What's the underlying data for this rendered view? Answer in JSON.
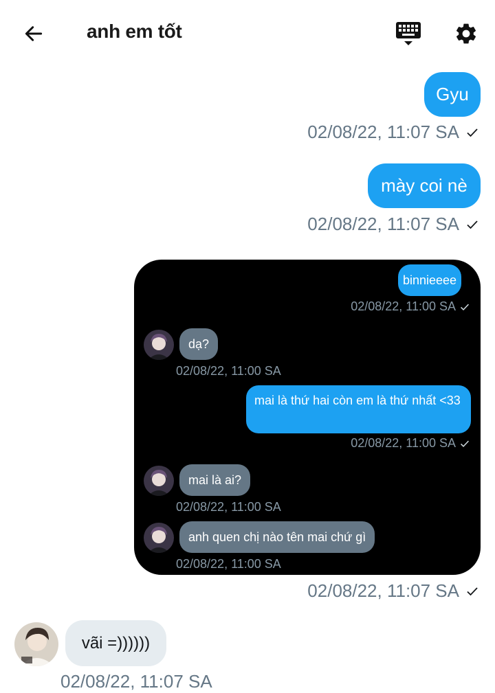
{
  "header": {
    "title": "anh em tốt",
    "back_icon": "arrow-left-icon",
    "keyboard_icon": "keyboard-icon",
    "settings_icon": "gear-icon"
  },
  "colors": {
    "outgoing": "#1da1f2",
    "incoming": "#e6ecf0",
    "timestamp": "#657786"
  },
  "messages": [
    {
      "text": "Gyu",
      "time": "02/08/22, 11:07 SA",
      "direction": "outgoing"
    },
    {
      "text": "mày coi nè",
      "time": "02/08/22, 11:07 SA",
      "direction": "outgoing"
    },
    {
      "type": "image",
      "time": "02/08/22, 11:07 SA",
      "direction": "outgoing"
    },
    {
      "text": "vãi =))))))",
      "time": "02/08/22, 11:07 SA",
      "direction": "incoming"
    }
  ],
  "screenshot": {
    "messages": [
      {
        "text": "binnieeee",
        "time": "02/08/22, 11:00 SA",
        "direction": "outgoing"
      },
      {
        "text": "dạ?",
        "time": "02/08/22, 11:00 SA",
        "direction": "incoming"
      },
      {
        "text": "mai là thứ hai còn em là thứ nhất <33",
        "time": "02/08/22, 11:00 SA",
        "direction": "outgoing"
      },
      {
        "text": "mai là ai?",
        "time": "02/08/22, 11:00 SA",
        "direction": "incoming"
      },
      {
        "text": "anh quen chị nào tên mai chứ gì",
        "time": "02/08/22, 11:00 SA",
        "direction": "incoming"
      }
    ]
  }
}
